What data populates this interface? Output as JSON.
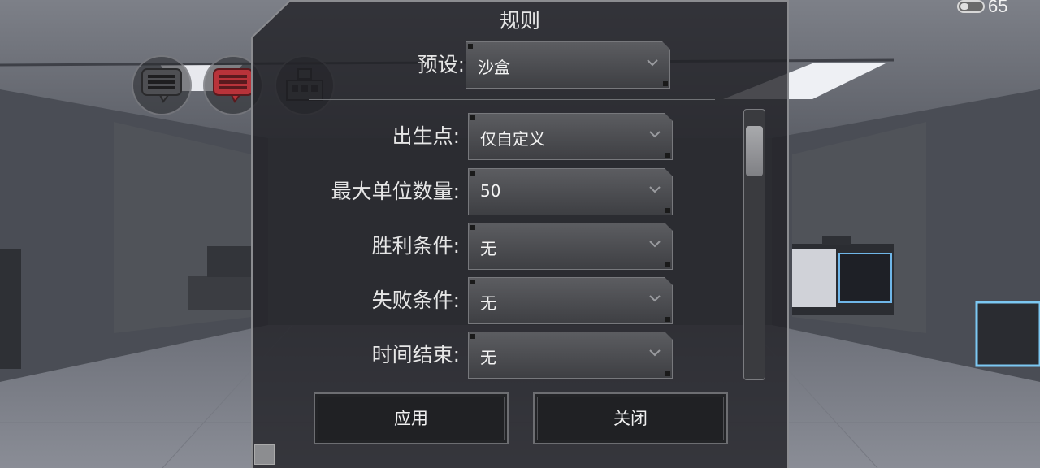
{
  "hud": {
    "battery_level": "65",
    "icons": [
      "chat-icon",
      "chat-alert-icon",
      "blocks-icon"
    ]
  },
  "panel": {
    "title": "规则",
    "preset_label": "预设:",
    "preset_value": "沙盒",
    "rows": [
      {
        "label": "出生点:",
        "value": "仅自定义"
      },
      {
        "label": "最大单位数量:",
        "value": "50"
      },
      {
        "label": "胜利条件:",
        "value": "无"
      },
      {
        "label": "失败条件:",
        "value": "无"
      },
      {
        "label": "时间结束:",
        "value": "无"
      }
    ],
    "apply_label": "应用",
    "close_label": "关闭"
  },
  "colors": {
    "panel_bg": "#202125",
    "dropdown_top": "#5c5d61",
    "dropdown_bottom": "#3e3f43",
    "alert_icon": "#b8333a",
    "text": "#e6e6e6"
  }
}
